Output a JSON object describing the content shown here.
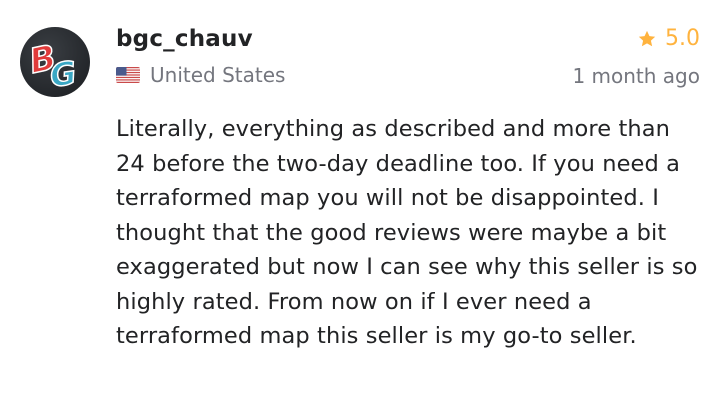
{
  "review": {
    "avatar_icon": "bg-logo-avatar",
    "avatar_text": "BG",
    "username": "bgc_chauv",
    "country": {
      "flag_icon": "us-flag-icon",
      "name": "United States"
    },
    "rating": {
      "icon": "star-icon",
      "value": "5.0",
      "color": "#ffb33e"
    },
    "time_ago": "1 month ago",
    "text": "Literally, everything as described and more than 24 before the two-day deadline too. If you need a terraformed map you will not be disappointed. I thought that the good reviews were maybe a bit exaggerated but now I can see why this seller is so highly rated. From now on if I ever need a terraformed map this seller is my go-to seller."
  }
}
